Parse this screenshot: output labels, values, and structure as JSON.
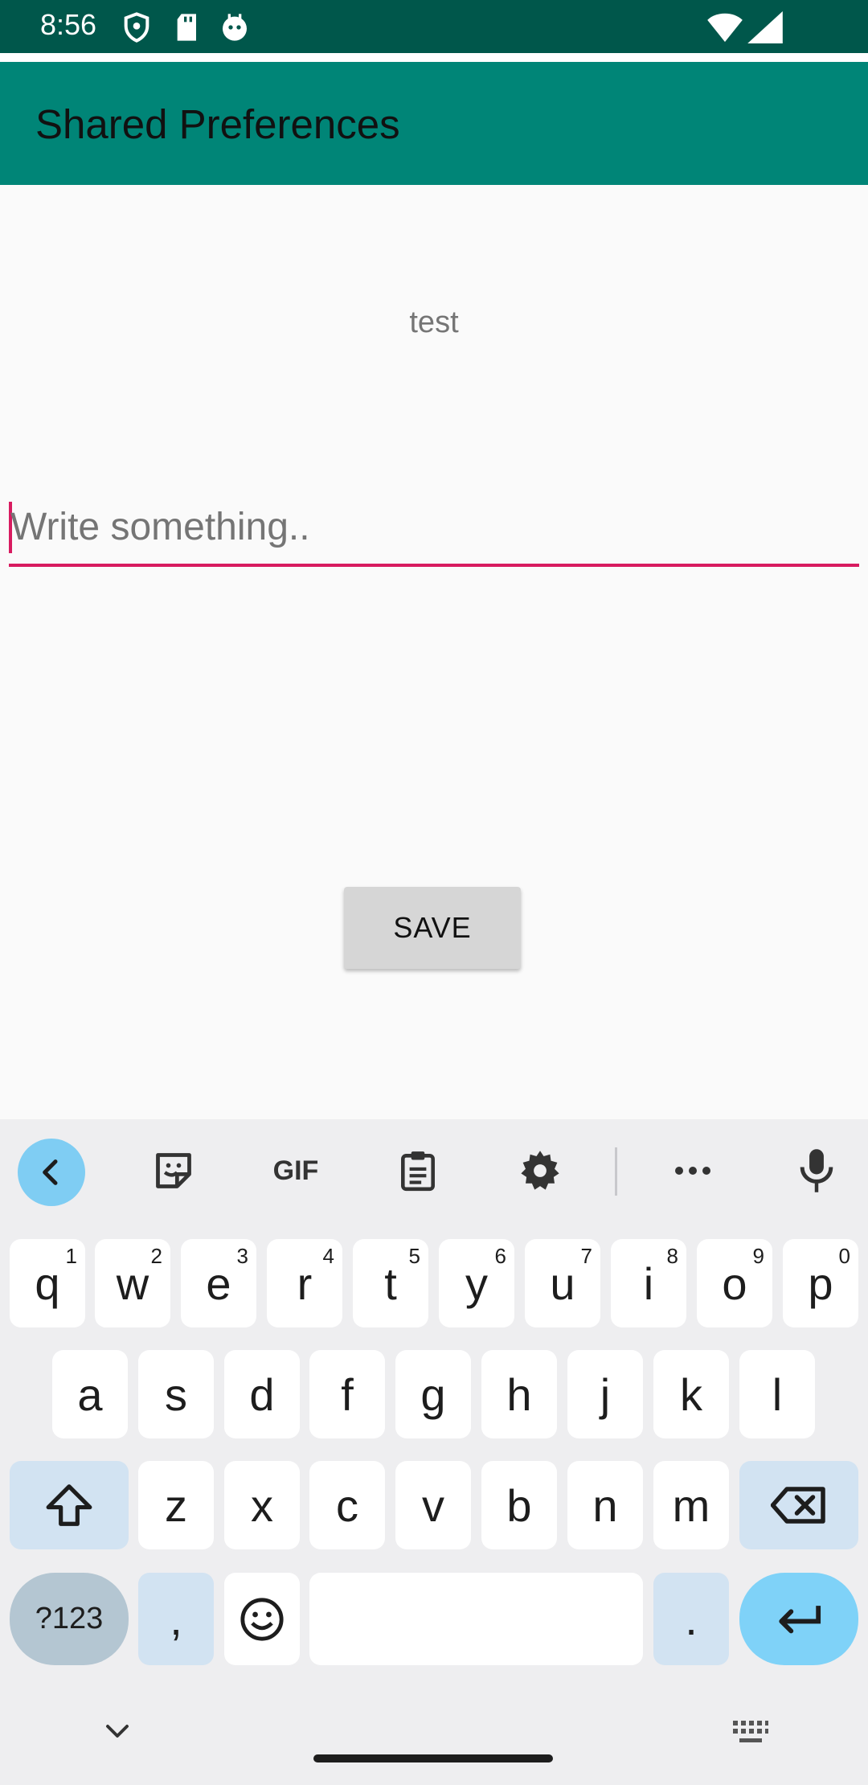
{
  "status_bar": {
    "time": "8:56",
    "icons": [
      "shield-icon",
      "sd-card-icon",
      "android-debug-icon",
      "wifi-icon",
      "signal-icon"
    ]
  },
  "app_bar": {
    "title": "Shared Preferences",
    "color": "#008577"
  },
  "main": {
    "display_text": "test",
    "input": {
      "value": "",
      "placeholder": "Write something.."
    },
    "save_label": "SAVE"
  },
  "keyboard": {
    "toolbar_icons": [
      "back-icon",
      "sticker-icon",
      "gif-icon",
      "clipboard-icon",
      "settings-icon",
      "more-icon",
      "microphone-icon"
    ],
    "gif_label": "GIF",
    "row1": [
      {
        "label": "q",
        "hint": "1"
      },
      {
        "label": "w",
        "hint": "2"
      },
      {
        "label": "e",
        "hint": "3"
      },
      {
        "label": "r",
        "hint": "4"
      },
      {
        "label": "t",
        "hint": "5"
      },
      {
        "label": "y",
        "hint": "6"
      },
      {
        "label": "u",
        "hint": "7"
      },
      {
        "label": "i",
        "hint": "8"
      },
      {
        "label": "o",
        "hint": "9"
      },
      {
        "label": "p",
        "hint": "0"
      }
    ],
    "row2": [
      "a",
      "s",
      "d",
      "f",
      "g",
      "h",
      "j",
      "k",
      "l"
    ],
    "row3": [
      "z",
      "x",
      "c",
      "v",
      "b",
      "n",
      "m"
    ],
    "row4": {
      "num_mode": "?123",
      "comma": ",",
      "period": "."
    },
    "accent_color": "#7fd2f8"
  }
}
